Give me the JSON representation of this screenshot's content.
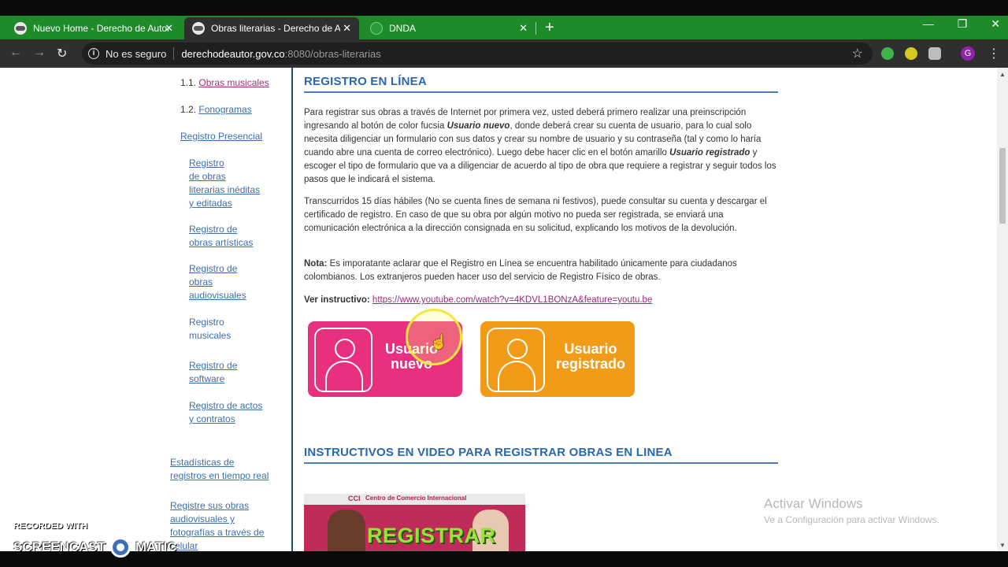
{
  "browser": {
    "tabs": [
      {
        "title": "Nuevo Home - Derecho de Autor",
        "close": "✕"
      },
      {
        "title": "Obras literarias - Derecho de Aut",
        "close": "✕"
      },
      {
        "title": "DNDA",
        "close": "✕"
      }
    ],
    "new_tab": "+",
    "window_controls": {
      "minimize": "—",
      "restore": "❐",
      "close": "✕"
    },
    "nav": {
      "back": "←",
      "forward": "→",
      "reload": "↻"
    },
    "address": {
      "security_label": "No es seguro",
      "host": "derechodeautor.gov.co",
      "rest": ":8080/obras-literarias"
    },
    "profile_initial": "G",
    "colors": {
      "tabbar": "#1e8a2a",
      "toolbar": "#2f2f2f"
    }
  },
  "sidebar": {
    "item_1_1_num": "1.1.",
    "item_1_1": "Obras musicales",
    "item_1_2_num": "1.2.",
    "item_1_2": "Fonogramas",
    "registro_presencial": "Registro Presencial",
    "sub1": [
      "Registro",
      "de obras",
      "literarias inéditas",
      " y editadas"
    ],
    "sub2": [
      "Registro de",
      "obras artísticas"
    ],
    "sub3": [
      "Registro de",
      "obras",
      "audiovisuales"
    ],
    "sub4": [
      "Registro",
      "musicales"
    ],
    "sub5": [
      "Registro de",
      "software"
    ],
    "sub6": [
      "Registro de actos",
      "y contratos"
    ],
    "estadisticas": [
      "Estadísticas de",
      "registros en tiempo real"
    ],
    "registre": [
      "Registre sus obras",
      "audiovisuales y",
      "fotografías a través de",
      "celular"
    ]
  },
  "content": {
    "heading1": "REGISTRO EN LÍNEA",
    "p1": {
      "a": "Para registrar sus obras a través de Internet por primera vez, usted deberá primero realizar una preinscripción ingresando al botón de color fucsia ",
      "b": "Usuario nuevo",
      "c": ", donde deberá crear su cuenta de usuario, para lo cual solo necesita diligenciar un formulario con sus datos y crear su nombre de usuario y su contraseña (tal y como lo haría cuando abre una cuenta de correo electrónico). Luego debe hacer clic en el botón amarillo ",
      "d": "Usuario registrado",
      "e": " y escoger el tipo de formulario que va a diligenciar de acuerdo al tipo de obra que requiere a registrar y seguir todos los pasos que le indicará el sistema."
    },
    "p2": "Transcurridos 15 días hábiles (No se cuenta fines de semana ni festivos), puede consultar su cuenta y descargar el certificado de registro. En caso de que su obra por algún motivo no pueda ser registrada, se enviará una comunicación electrónica a la dirección consignada en su solicitud, explicando los motivos de la devolución.",
    "p3": {
      "label": "Nota:",
      "text": " Es imporatante aclarar que el Registro en Línea se encuentra habilitado únicamente para ciudadanos colombianos. Los extranjeros pueden hacer uso del servicio de Registro Físico de obras."
    },
    "p4": {
      "label": "Ver instructivo:",
      "link": "https://www.youtube.com/watch?v=4KDVL1BONzA&feature=youtu.be"
    },
    "btn_nuevo": [
      "Usuario",
      "nuevo"
    ],
    "btn_registrado": [
      "Usuario",
      "registrado"
    ],
    "heading2": "INSTRUCTIVOS EN VIDEO PARA REGISTRAR OBRAS EN LINEA",
    "video": {
      "banner": "Centro de Comercio Internacional",
      "logo": "CCI",
      "word": "REGISTRAR"
    },
    "colors": {
      "pink": "#e8307e",
      "orange": "#f29b16",
      "heading": "#2a67ad"
    }
  },
  "overlay": {
    "activate_title": "Activar Windows",
    "activate_sub": "Ve a Configuración para activar Windows.",
    "recorded_with": "RECORDED WITH",
    "screencast_a": "SCREENCAST",
    "screencast_b": "MATIC"
  }
}
